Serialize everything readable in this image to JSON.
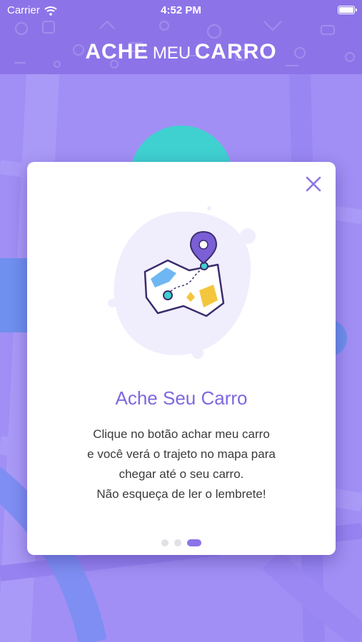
{
  "status_bar": {
    "carrier": "Carrier",
    "time": "4:52 PM",
    "battery_level": 1.0
  },
  "brand": {
    "part1": "ACHE",
    "part2": "MEU",
    "part3": "CARRO"
  },
  "modal": {
    "title": "Ache Seu Carro",
    "lines": [
      "Clique no botão achar meu carro",
      "e você verá o trajeto no mapa para",
      "chegar até o seu carro.",
      "Não esqueça de ler o lembrete!"
    ],
    "pager": {
      "total": 3,
      "current": 3
    }
  },
  "colors": {
    "header": "#8c74e8",
    "map_background": "#a18ff5",
    "accent": "#8c74e8",
    "title": "#7f67de",
    "teal": "#3fd1cf",
    "yellow": "#f4c63d",
    "blue": "#6fb7f2"
  },
  "icons": {
    "close": "close-icon",
    "illustration": "map-pin-illustration",
    "wifi": "wifi-icon",
    "battery": "battery-icon"
  }
}
